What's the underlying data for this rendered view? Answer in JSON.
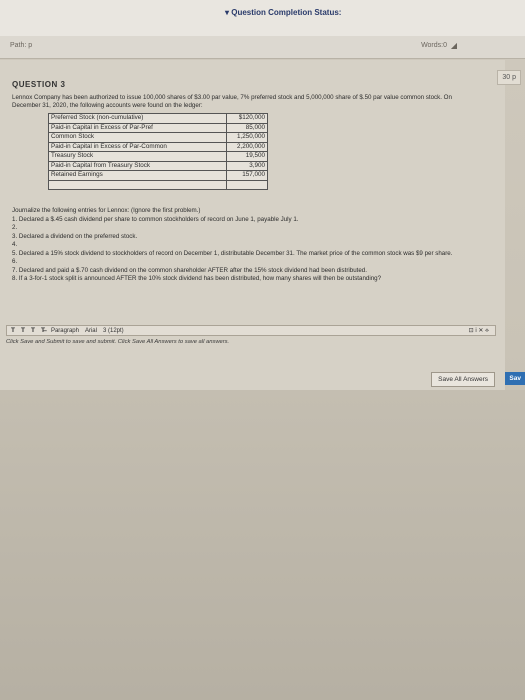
{
  "header": {
    "status_link": "▾ Question Completion Status:",
    "path_label": "Path: p",
    "words_label": "Words:0",
    "resize_icon": "◢"
  },
  "question": {
    "title": "QUESTION 3",
    "points": "30 p",
    "text": "Lennox Company has been authorized to issue 100,000 shares of $3.00 par value, 7% preferred stock and 5,000,000 share of $.50 par value common stock. On December 31, 2020, the following accounts were found on the ledger:"
  },
  "ledger": {
    "rows": [
      {
        "account": "Preferred Stock (non-cumulative)",
        "amount": "$120,000"
      },
      {
        "account": "Paid-in Capital in Excess of Par-Pref",
        "amount": "85,000"
      },
      {
        "account": "Common Stock",
        "amount": "1,250,000"
      },
      {
        "account": "Paid-in Capital in Excess of Par-Common",
        "amount": "2,200,000"
      },
      {
        "account": "Treasury Stock",
        "amount": "19,500"
      },
      {
        "account": "Paid-in Capital from Treasury Stock",
        "amount": "3,900"
      },
      {
        "account": "Retained Earnings",
        "amount": "157,000"
      },
      {
        "account": "",
        "amount": ""
      }
    ]
  },
  "instructions": {
    "intro": "Journalize the following entries for Lennox: (Ignore the first problem.)",
    "items": [
      "1. Declared a $.45 cash dividend per share to common stockholders of record on June 1, payable July 1.",
      "2.",
      "3. Declared a dividend on the preferred stock.",
      "4.",
      "5. Declared a 15% stock dividend to stockholders of record on December 1, distributable December 31. The market price of the common stock was $9 per share.",
      "6.",
      "7. Declared and paid a $.70 cash dividend on the common shareholder AFTER after the 15% stock dividend had been distributed.",
      "8. If a 3-for-1 stock split is announced AFTER the 10% stock dividend has been distributed, how many shares will then be outstanding?"
    ]
  },
  "toolbar": {
    "format_buttons": [
      "T",
      "T",
      "T",
      "T̶"
    ],
    "paragraph": "Paragraph",
    "font": "Arial",
    "size": "3 (12pt)",
    "right_icons": "⊡ i ✕ ⟡"
  },
  "footer": {
    "hint": "Click Save and Submit to save and submit. Click Save All Answers to save all answers.",
    "save_all": "Save All Answers",
    "save_edge": "Sav"
  }
}
